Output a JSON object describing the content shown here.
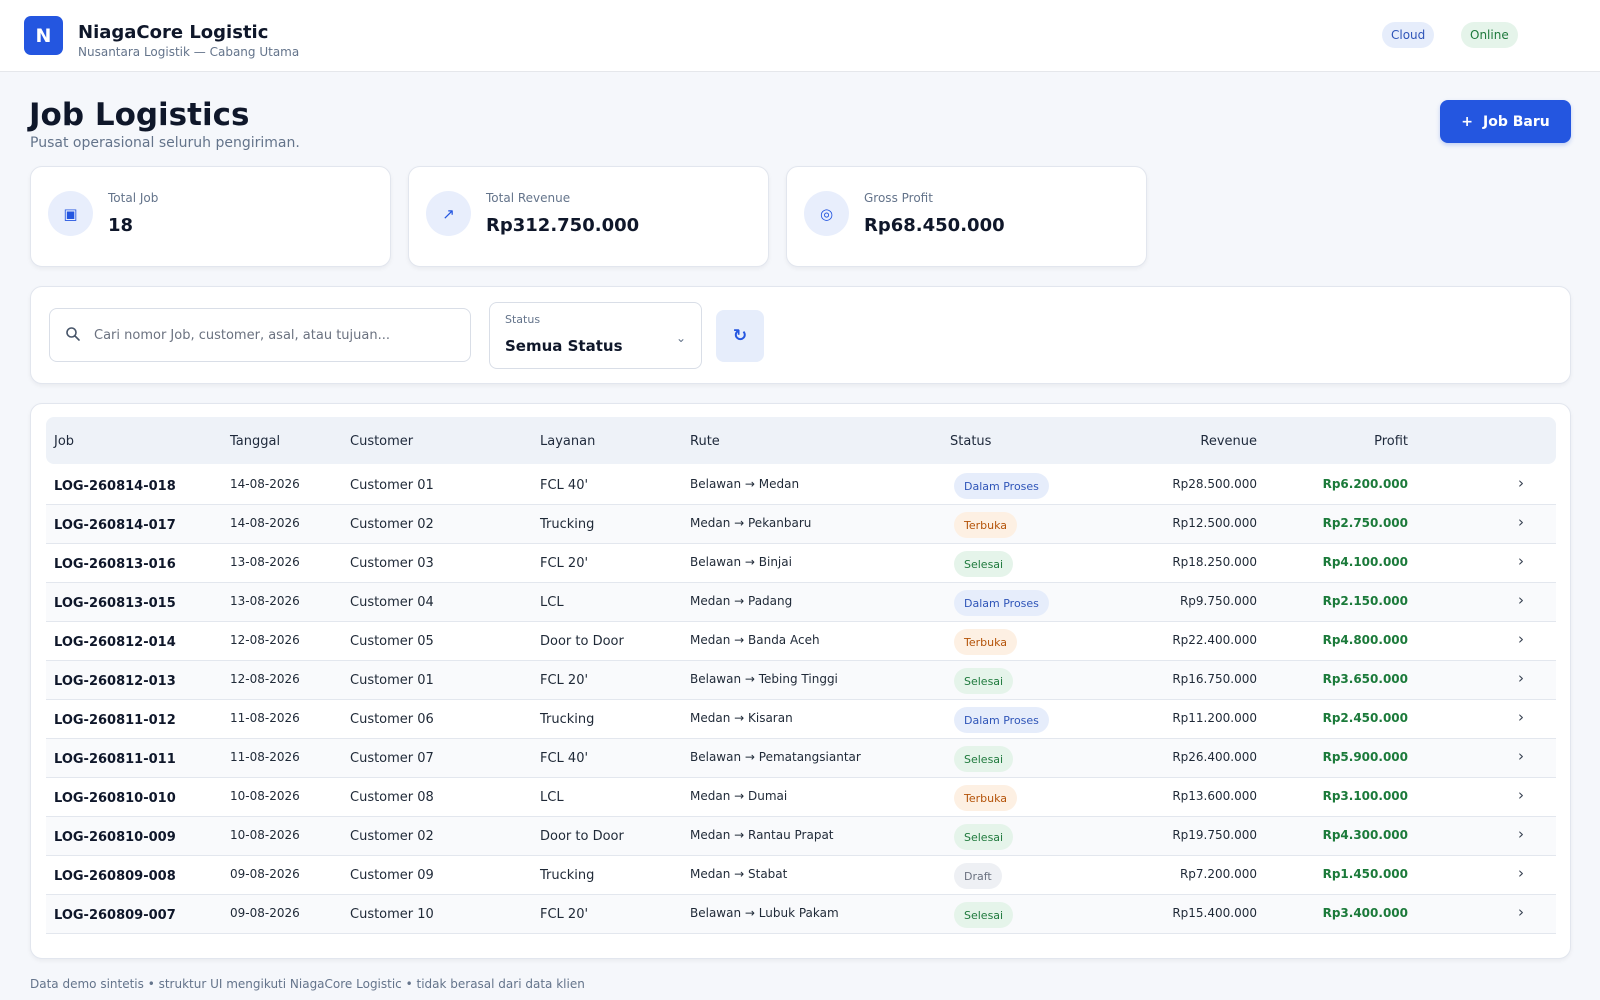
{
  "header": {
    "logo_letter": "N",
    "app_title": "NiagaCore Logistic",
    "app_subtitle": "Nusantara Logistik — Cabang Utama",
    "pill_cloud": "Cloud",
    "pill_online": "Online"
  },
  "page": {
    "title": "Job Logistics",
    "subtitle": "Pusat operasional seluruh pengiriman.",
    "new_job_label": "Job Baru",
    "new_job_icon": "+"
  },
  "stats": [
    {
      "label": "Total Job",
      "value": "18",
      "icon": "box-icon",
      "glyph": "▣"
    },
    {
      "label": "Total Revenue",
      "value": "Rp312.750.000",
      "icon": "trend-up-icon",
      "glyph": "↗"
    },
    {
      "label": "Gross Profit",
      "value": "Rp68.450.000",
      "icon": "target-icon",
      "glyph": "◎"
    }
  ],
  "filters": {
    "search_placeholder": "Cari nomor Job, customer, asal, atau tujuan...",
    "search_value": "",
    "status_caption": "Status",
    "status_value": "Semua Status",
    "refresh_glyph": "↻"
  },
  "table": {
    "columns": [
      "Job",
      "Tanggal",
      "Customer",
      "Layanan",
      "Rute",
      "Status",
      "Revenue",
      "Profit"
    ],
    "rows": [
      {
        "job": "LOG-260814-018",
        "date": "14-08-2026",
        "customer": "Customer 01",
        "service": "FCL 40'",
        "route": "Belawan → Medan",
        "status": "Dalam Proses",
        "revenue": "Rp28.500.000",
        "profit": "Rp6.200.000"
      },
      {
        "job": "LOG-260814-017",
        "date": "14-08-2026",
        "customer": "Customer 02",
        "service": "Trucking",
        "route": "Medan → Pekanbaru",
        "status": "Terbuka",
        "revenue": "Rp12.500.000",
        "profit": "Rp2.750.000"
      },
      {
        "job": "LOG-260813-016",
        "date": "13-08-2026",
        "customer": "Customer 03",
        "service": "FCL 20'",
        "route": "Belawan → Binjai",
        "status": "Selesai",
        "revenue": "Rp18.250.000",
        "profit": "Rp4.100.000"
      },
      {
        "job": "LOG-260813-015",
        "date": "13-08-2026",
        "customer": "Customer 04",
        "service": "LCL",
        "route": "Medan → Padang",
        "status": "Dalam Proses",
        "revenue": "Rp9.750.000",
        "profit": "Rp2.150.000"
      },
      {
        "job": "LOG-260812-014",
        "date": "12-08-2026",
        "customer": "Customer 05",
        "service": "Door to Door",
        "route": "Medan → Banda Aceh",
        "status": "Terbuka",
        "revenue": "Rp22.400.000",
        "profit": "Rp4.800.000"
      },
      {
        "job": "LOG-260812-013",
        "date": "12-08-2026",
        "customer": "Customer 01",
        "service": "FCL 20'",
        "route": "Belawan → Tebing Tinggi",
        "status": "Selesai",
        "revenue": "Rp16.750.000",
        "profit": "Rp3.650.000"
      },
      {
        "job": "LOG-260811-012",
        "date": "11-08-2026",
        "customer": "Customer 06",
        "service": "Trucking",
        "route": "Medan → Kisaran",
        "status": "Dalam Proses",
        "revenue": "Rp11.200.000",
        "profit": "Rp2.450.000"
      },
      {
        "job": "LOG-260811-011",
        "date": "11-08-2026",
        "customer": "Customer 07",
        "service": "FCL 40'",
        "route": "Belawan → Pematangsiantar",
        "status": "Selesai",
        "revenue": "Rp26.400.000",
        "profit": "Rp5.900.000"
      },
      {
        "job": "LOG-260810-010",
        "date": "10-08-2026",
        "customer": "Customer 08",
        "service": "LCL",
        "route": "Medan → Dumai",
        "status": "Terbuka",
        "revenue": "Rp13.600.000",
        "profit": "Rp3.100.000"
      },
      {
        "job": "LOG-260810-009",
        "date": "10-08-2026",
        "customer": "Customer 02",
        "service": "Door to Door",
        "route": "Medan → Rantau Prapat",
        "status": "Selesai",
        "revenue": "Rp19.750.000",
        "profit": "Rp4.300.000"
      },
      {
        "job": "LOG-260809-008",
        "date": "09-08-2026",
        "customer": "Customer 09",
        "service": "Trucking",
        "route": "Medan → Stabat",
        "status": "Draft",
        "revenue": "Rp7.200.000",
        "profit": "Rp1.450.000"
      },
      {
        "job": "LOG-260809-007",
        "date": "09-08-2026",
        "customer": "Customer 10",
        "service": "FCL 20'",
        "route": "Belawan → Lubuk Pakam",
        "status": "Selesai",
        "revenue": "Rp15.400.000",
        "profit": "Rp3.400.000"
      }
    ]
  },
  "status_colors": {
    "Dalam Proses": {
      "bg": "#e6edfb",
      "fg": "#2f55b8"
    },
    "Terbuka": {
      "bg": "#fdf0e3",
      "fg": "#b45309"
    },
    "Selesai": {
      "bg": "#e5f4ea",
      "fg": "#1f7a3d"
    },
    "Draft": {
      "bg": "#eef0f4",
      "fg": "#6b7280"
    }
  },
  "theme": {
    "accent": "#2456e0",
    "profit": "#1b7a3a"
  },
  "footer": {
    "note": "Data demo sintetis • struktur UI mengikuti NiagaCore Logistic • tidak berasal dari data klien"
  }
}
